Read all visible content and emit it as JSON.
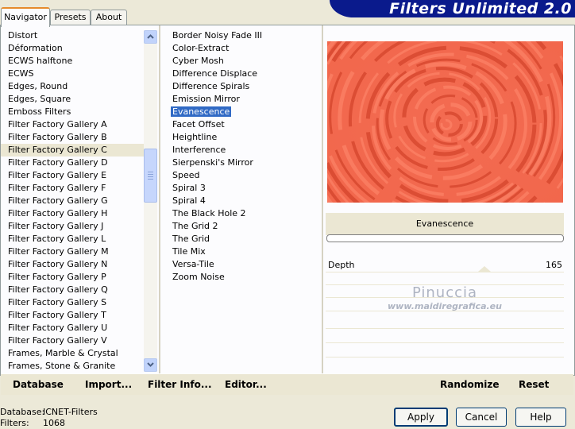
{
  "tabs": [
    "Navigator",
    "Presets",
    "About"
  ],
  "app_title": "Filters Unlimited 2.0",
  "categories": [
    "Distort",
    "Déformation",
    "ECWS halftone",
    "ECWS",
    "Edges, Round",
    "Edges, Square",
    "Emboss Filters",
    "Filter Factory Gallery A",
    "Filter Factory Gallery B",
    "Filter Factory Gallery C",
    "Filter Factory Gallery D",
    "Filter Factory Gallery E",
    "Filter Factory Gallery F",
    "Filter Factory Gallery G",
    "Filter Factory Gallery H",
    "Filter Factory Gallery J",
    "Filter Factory Gallery L",
    "Filter Factory Gallery M",
    "Filter Factory Gallery N",
    "Filter Factory Gallery P",
    "Filter Factory Gallery Q",
    "Filter Factory Gallery S",
    "Filter Factory Gallery T",
    "Filter Factory Gallery U",
    "Filter Factory Gallery V",
    "Frames, Marble & Crystal",
    "Frames, Stone & Granite"
  ],
  "selected_category": "Filter Factory Gallery C",
  "filters": [
    "Border Noisy Fade III",
    "Color-Extract",
    "Cyber Mosh",
    "Difference Displace",
    "Difference Spirals",
    "Emission Mirror",
    "Evanescence",
    "Facet Offset",
    "Heightline",
    "Interference",
    "Sierpenski's Mirror",
    "Speed",
    "Spiral 3",
    "Spiral 4",
    "The Black Hole 2",
    "The Grid 2",
    "The Grid",
    "Tile Mix",
    "Versa-Tile",
    "Zoom Noise"
  ],
  "selected_filter": "Evanescence",
  "preview_caption": "Evanescence",
  "param": {
    "label": "Depth",
    "value": "165"
  },
  "watermark": {
    "line1": "Pinuccia",
    "line2": "www.maidiregrafica.eu"
  },
  "toolbar": {
    "database": "Database",
    "import": "Import...",
    "filter_info": "Filter Info...",
    "editor": "Editor...",
    "randomize": "Randomize",
    "reset": "Reset"
  },
  "status": {
    "database_label": "Database:",
    "database_value": "ICNET-Filters",
    "filters_label": "Filters:",
    "filters_value": "1068"
  },
  "buttons": {
    "apply": "Apply",
    "cancel": "Cancel",
    "help": "Help"
  },
  "colors": {
    "selection": "#316ac5",
    "banner": "#0a1a8c",
    "preview_base": "#f26a4e"
  }
}
